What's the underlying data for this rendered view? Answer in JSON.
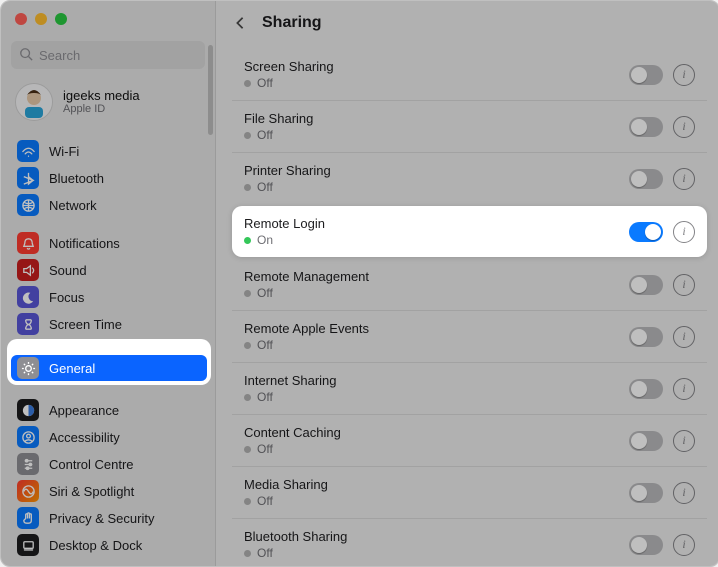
{
  "header": {
    "title": "Sharing",
    "back_aria": "Back"
  },
  "search": {
    "placeholder": "Search"
  },
  "account": {
    "name": "igeeks media",
    "sub": "Apple ID"
  },
  "sidebar": {
    "items": [
      {
        "key": "wifi",
        "label": "Wi-Fi",
        "color": "bg-blue",
        "glyph": "wifi"
      },
      {
        "key": "bluetooth",
        "label": "Bluetooth",
        "color": "bg-blue",
        "glyph": "bt"
      },
      {
        "key": "network",
        "label": "Network",
        "color": "bg-blue",
        "glyph": "globe"
      },
      {
        "key": "notifications",
        "label": "Notifications",
        "color": "bg-red",
        "glyph": "bell"
      },
      {
        "key": "sound",
        "label": "Sound",
        "color": "bg-darkred",
        "glyph": "speaker"
      },
      {
        "key": "focus",
        "label": "Focus",
        "color": "bg-purple",
        "glyph": "moon"
      },
      {
        "key": "screentime",
        "label": "Screen Time",
        "color": "bg-purple",
        "glyph": "hourglass"
      },
      {
        "key": "general",
        "label": "General",
        "color": "bg-gray",
        "glyph": "gear",
        "selected": true,
        "highlight": true
      },
      {
        "key": "appearance",
        "label": "Appearance",
        "color": "bg-black",
        "glyph": "appearance"
      },
      {
        "key": "accessibility",
        "label": "Accessibility",
        "color": "bg-blue",
        "glyph": "person"
      },
      {
        "key": "controlcentre",
        "label": "Control Centre",
        "color": "bg-gray",
        "glyph": "sliders"
      },
      {
        "key": "siri",
        "label": "Siri & Spotlight",
        "color": "bg-teal",
        "glyph": "siri"
      },
      {
        "key": "privacy",
        "label": "Privacy & Security",
        "color": "bg-blue",
        "glyph": "hand"
      },
      {
        "key": "desktop",
        "label": "Desktop & Dock",
        "color": "bg-black",
        "glyph": "dock"
      }
    ]
  },
  "rows": [
    {
      "key": "screen-sharing",
      "title": "Screen Sharing",
      "status": "Off",
      "on": false
    },
    {
      "key": "file-sharing",
      "title": "File Sharing",
      "status": "Off",
      "on": false
    },
    {
      "key": "printer-sharing",
      "title": "Printer Sharing",
      "status": "Off",
      "on": false
    },
    {
      "key": "remote-login",
      "title": "Remote Login",
      "status": "On",
      "on": true,
      "highlight": true
    },
    {
      "key": "remote-management",
      "title": "Remote Management",
      "status": "Off",
      "on": false
    },
    {
      "key": "remote-apple-events",
      "title": "Remote Apple Events",
      "status": "Off",
      "on": false
    },
    {
      "key": "internet-sharing",
      "title": "Internet Sharing",
      "status": "Off",
      "on": false
    },
    {
      "key": "content-caching",
      "title": "Content Caching",
      "status": "Off",
      "on": false
    },
    {
      "key": "media-sharing",
      "title": "Media Sharing",
      "status": "Off",
      "on": false
    },
    {
      "key": "bluetooth-sharing",
      "title": "Bluetooth Sharing",
      "status": "Off",
      "on": false
    }
  ]
}
